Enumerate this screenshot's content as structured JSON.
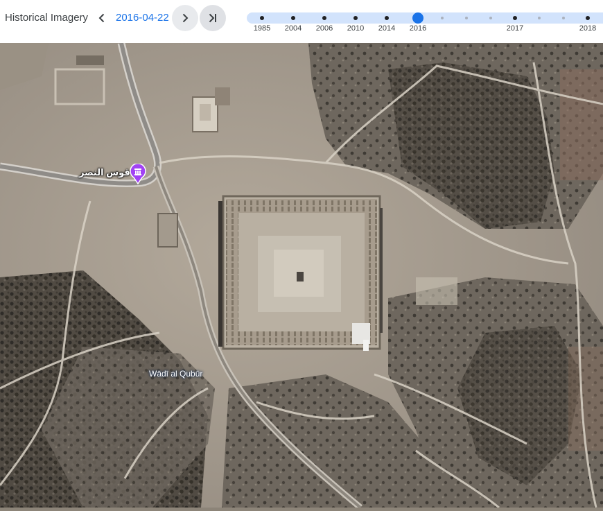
{
  "toolbar": {
    "title": "Historical Imagery",
    "date": "2016-04-22",
    "prev_icon": "chevron-left-icon",
    "next_icon": "chevron-right-icon",
    "latest_icon": "skip-to-latest-icon"
  },
  "timeline": {
    "selected": "2016-04-22",
    "labels": [
      "1985",
      "2004",
      "2006",
      "2010",
      "2014",
      "2016",
      "2017",
      "2018"
    ]
  },
  "map": {
    "poi_label": "قوس النصر",
    "poi_icon": "landmark-pin-icon",
    "area_label": "Wādī al Qubūr"
  },
  "colors": {
    "accent": "#1a73e8",
    "track": "#d2e3fc",
    "poi": "#a142f4"
  }
}
